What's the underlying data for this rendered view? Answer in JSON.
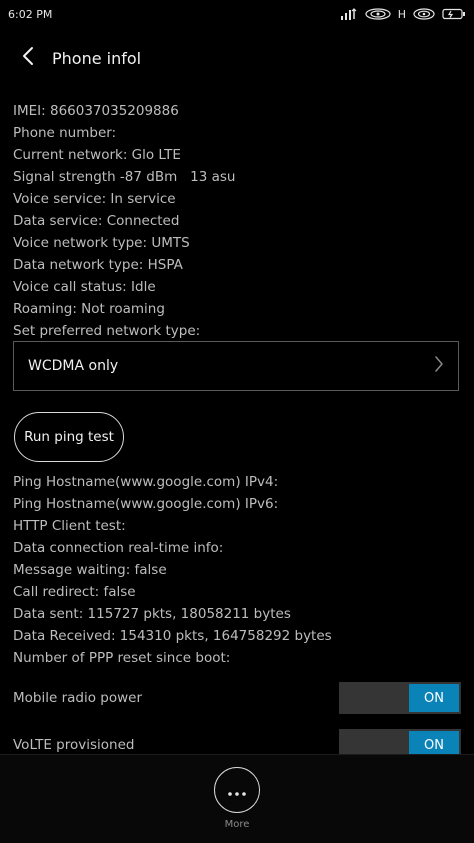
{
  "status_bar": {
    "time": "6:02 PM",
    "network_type": "H",
    "icons": [
      "signal-icon",
      "wifi-icon",
      "battery-icon"
    ]
  },
  "header": {
    "title": "Phone infol",
    "back_icon": "chevron-left-icon"
  },
  "info_lines": [
    "IMEI: 866037035209886",
    "Phone number:",
    "Current network: Glo LTE",
    "Signal strength -87 dBm   13 asu",
    "Voice service: In service",
    "Data service: Connected",
    "Voice network type: UMTS",
    "Data network type: HSPA",
    "Voice call status: Idle",
    "Roaming: Not roaming",
    "Set preferred network type:"
  ],
  "preferred_network": {
    "selected": "WCDMA only",
    "icon": "chevron-right-icon"
  },
  "ping_button": {
    "label": "Run ping test"
  },
  "info_lines_2": [
    "Ping Hostname(www.google.com) IPv4:",
    "Ping Hostname(www.google.com) IPv6:",
    "HTTP Client test:",
    "Data connection real-time info:",
    "Message waiting: false",
    "Call redirect: false",
    "Data sent: 115727 pkts, 18058211 bytes",
    "Data Received: 154310 pkts, 164758292 bytes",
    "Number of PPP reset since boot:"
  ],
  "toggles": [
    {
      "label": "Mobile radio power",
      "state": "ON"
    },
    {
      "label": "VoLTE provisioned",
      "state": "ON"
    }
  ],
  "bottom": {
    "more_label": "More",
    "icon": "more-dots-icon"
  },
  "colors": {
    "background": "#000000",
    "accent": "#0a84b8",
    "toggle_track": "#353535"
  }
}
